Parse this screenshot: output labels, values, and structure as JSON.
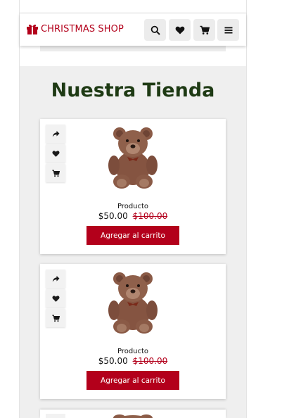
{
  "header": {
    "logo_text": "CHRISTMAS SHOP",
    "icons": [
      "search-icon",
      "heart-icon",
      "cart-icon",
      "menu-icon"
    ]
  },
  "main": {
    "title": "Nuestra Tienda"
  },
  "products": [
    {
      "name": "Producto",
      "price": "$50.00",
      "old_price": "$100.00",
      "button_label": "Agregar al carrito"
    },
    {
      "name": "Producto",
      "price": "$50.00",
      "old_price": "$100.00",
      "button_label": "Agregar al carrito"
    }
  ],
  "colors": {
    "brand_red": "#b3001b",
    "title_green": "#1e3a14",
    "section_bg": "#efefef"
  }
}
